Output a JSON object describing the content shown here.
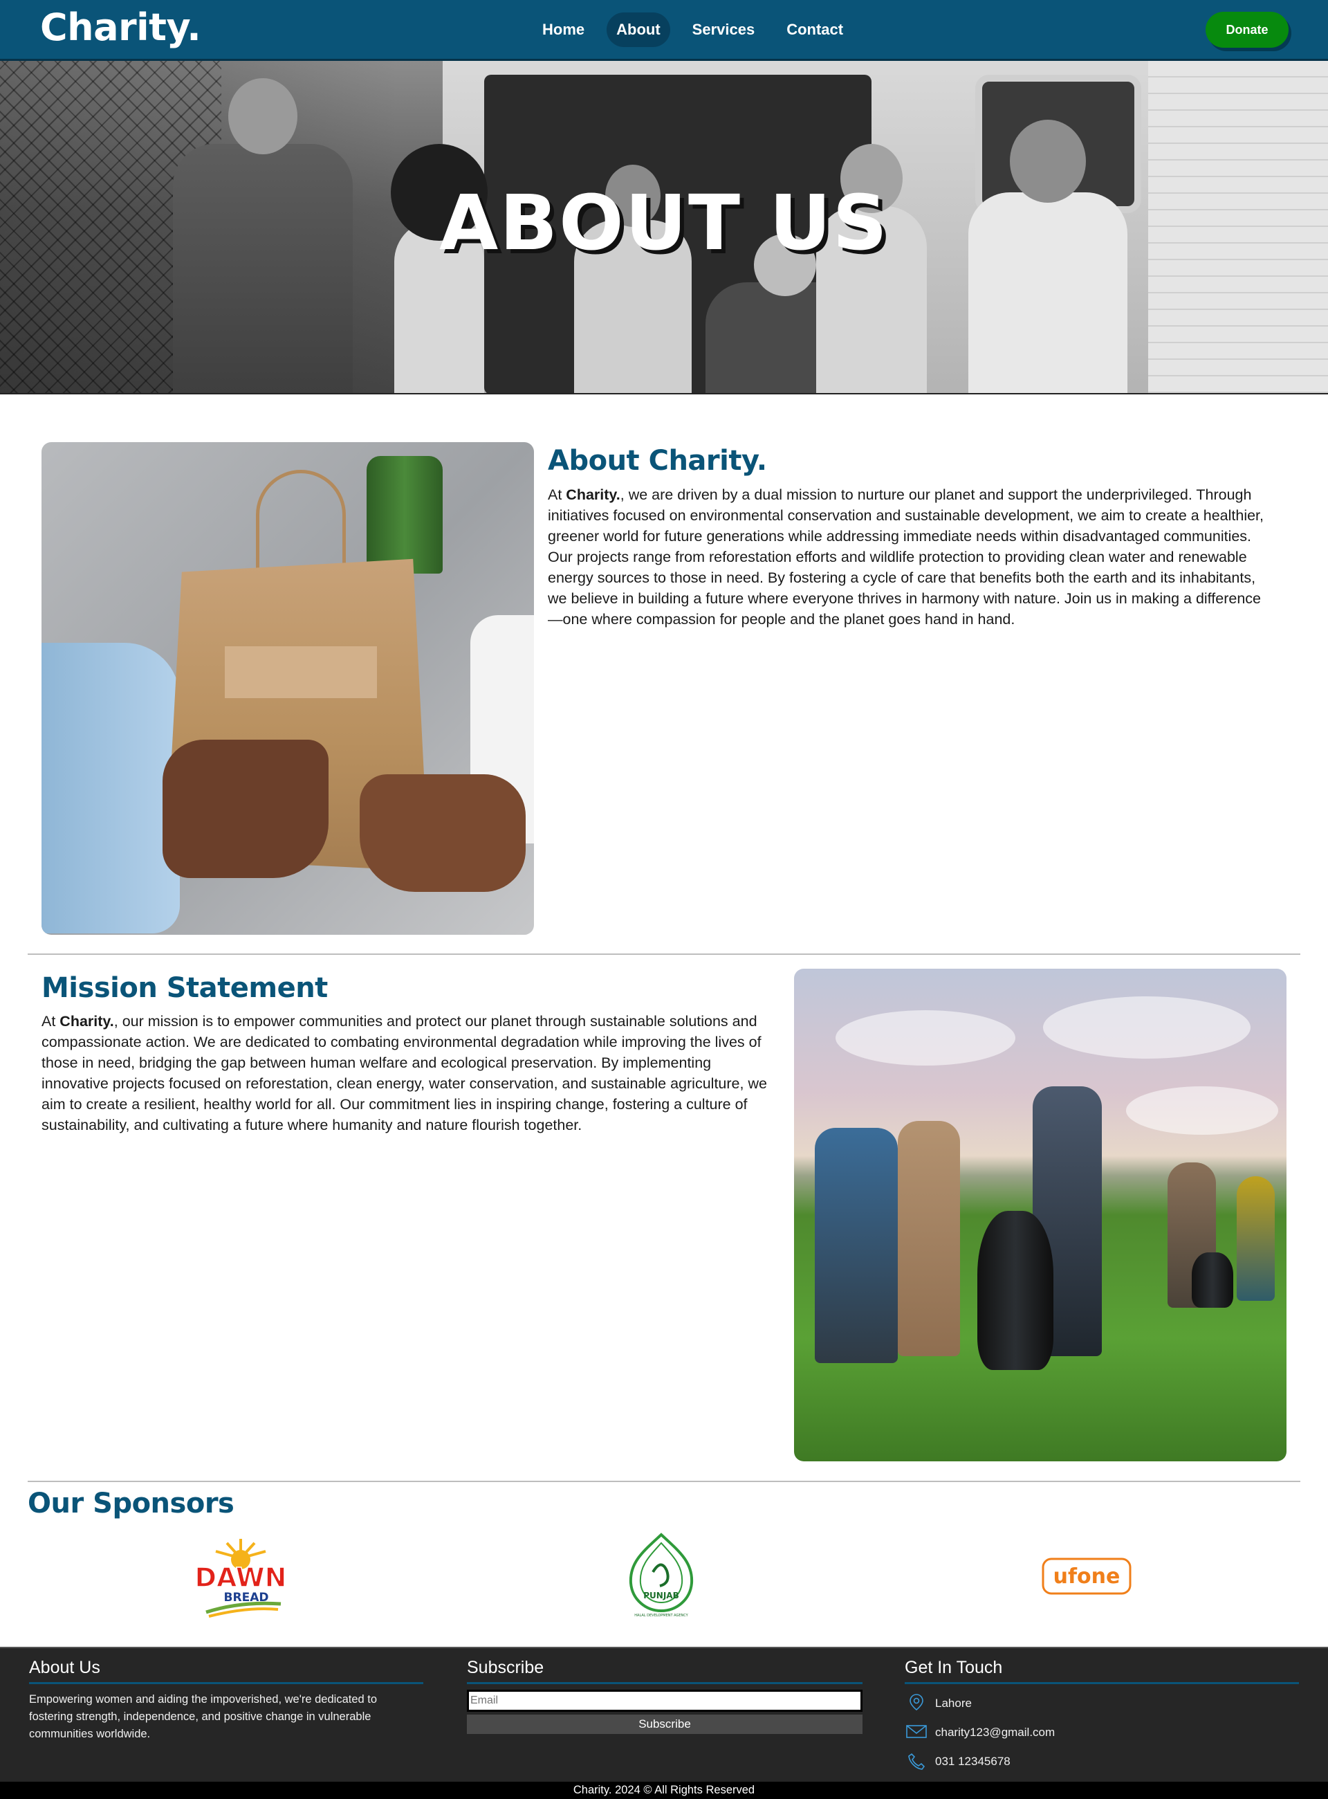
{
  "nav": {
    "brand": "Charity.",
    "links": [
      {
        "label": "Home"
      },
      {
        "label": "About",
        "active": true
      },
      {
        "label": "Services"
      },
      {
        "label": "Contact"
      }
    ],
    "donate_label": "Donate"
  },
  "hero": {
    "title": "ABOUT US"
  },
  "about": {
    "title": "About Charity.",
    "text_prefix": "At ",
    "brand_bold": "Charity.",
    "text_body": ", we are driven by a dual mission to nurture our planet and support the underprivileged. Through initiatives focused on environmental conservation and sustainable development, we aim to create a healthier, greener world for future generations while addressing immediate needs within disadvantaged communities. Our projects range from reforestation efforts and wildlife protection to providing clean water and renewable energy sources to those in need. By fostering a cycle of care that benefits both the earth and its inhabitants, we believe in building a future where everyone thrives in harmony with nature. Join us in making a difference—one where compassion for people and the planet goes hand in hand."
  },
  "mission": {
    "title": "Mission Statement",
    "text_prefix": "At ",
    "brand_bold": "Charity.",
    "text_body": ", our mission is to empower communities and protect our planet through sustainable solutions and compassionate action. We are dedicated to combating environmental degradation while improving the lives of those in need, bridging the gap between human welfare and ecological preservation. By implementing innovative projects focused on reforestation, clean energy, water conservation, and sustainable agriculture, we aim to create a resilient, healthy world for all. Our commitment lies in inspiring change, fostering a culture of sustainability, and cultivating a future where humanity and nature flourish together."
  },
  "sponsors": {
    "title": "Our Sponsors",
    "logos": [
      {
        "name": "dawn-bread-logo",
        "line1": "DAWN",
        "line2": "BREAD"
      },
      {
        "name": "punjab-halal-logo",
        "line1": "PUNJAB",
        "line2": "HALAL DEVELOPMENT AGENCY"
      },
      {
        "name": "ufone-logo",
        "line1": "ufone"
      }
    ]
  },
  "footer": {
    "about_title": "About Us",
    "about_text": "Empowering women and aiding the impoverished, we're dedicated to fostering strength, independence, and positive change in vulnerable communities worldwide.",
    "subscribe_title": "Subscribe",
    "email_placeholder": "Email",
    "subscribe_label": "Subscribe",
    "contact_title": "Get In Touch",
    "contacts": [
      {
        "icon": "location-icon",
        "text": "Lahore"
      },
      {
        "icon": "mail-icon",
        "text": "charity123@gmail.com"
      },
      {
        "icon": "phone-icon",
        "text": "031 12345678"
      }
    ],
    "copyright": "Charity. 2024 © All Rights Reserved"
  },
  "colors": {
    "primary": "#0a5478",
    "donate": "#078a0e",
    "footer_bg": "#262626"
  }
}
